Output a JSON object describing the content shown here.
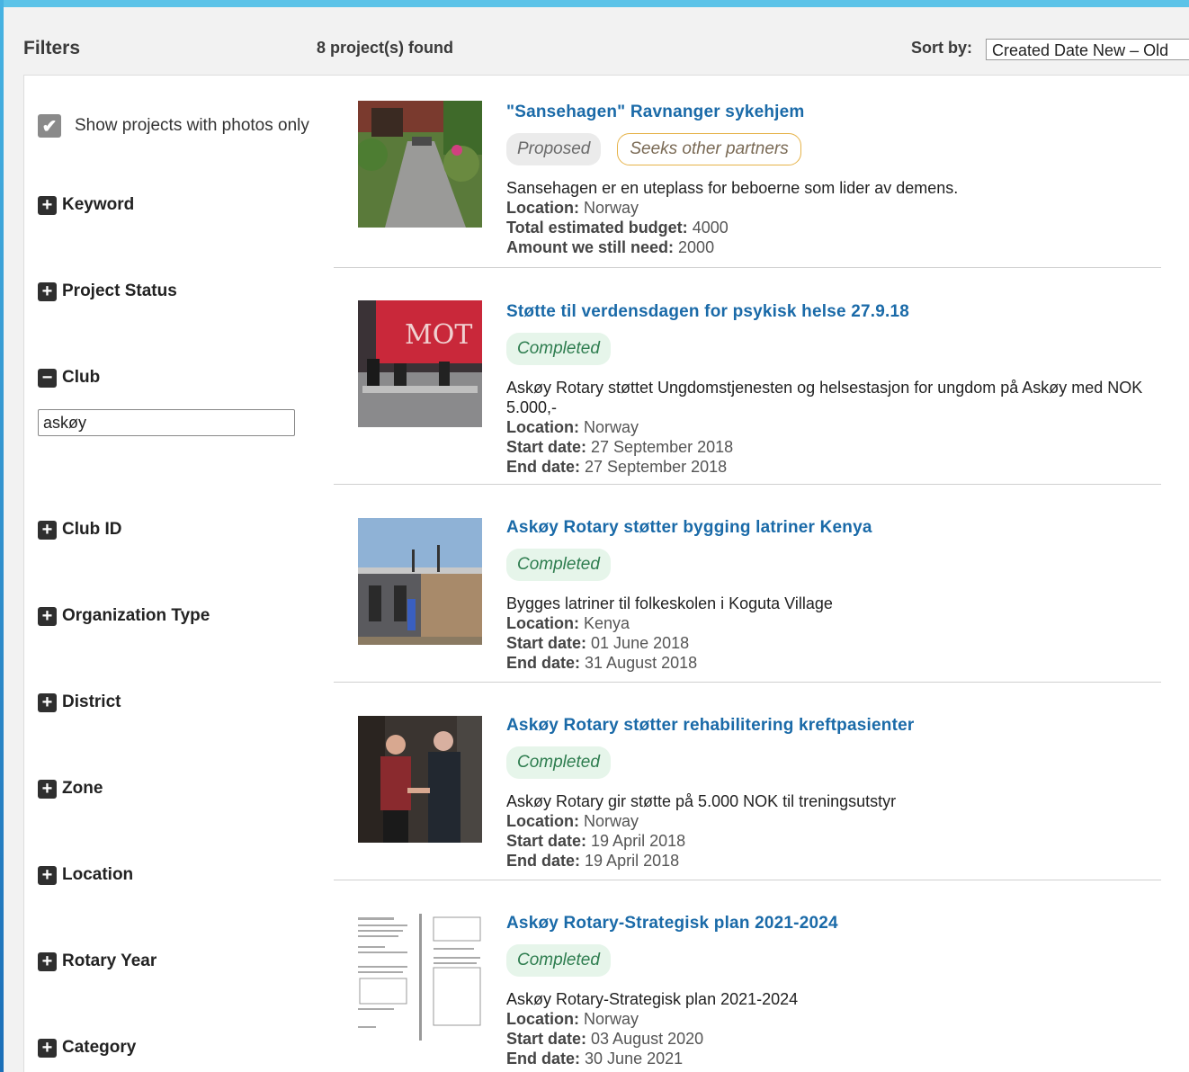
{
  "header": {
    "filters_title": "Filters",
    "result_count": "8 project(s) found",
    "sort_label": "Sort by:",
    "sort_value": "Created Date New – Old"
  },
  "sidebar": {
    "photo_only_label": "Show projects with photos only",
    "photo_only_checked": true,
    "groups": [
      {
        "label": "Keyword",
        "toggle": "+"
      },
      {
        "label": "Project Status",
        "toggle": "+"
      },
      {
        "label": "Club",
        "toggle": "−"
      },
      {
        "label": "Club ID",
        "toggle": "+"
      },
      {
        "label": "Organization Type",
        "toggle": "+"
      },
      {
        "label": "District",
        "toggle": "+"
      },
      {
        "label": "Zone",
        "toggle": "+"
      },
      {
        "label": "Location",
        "toggle": "+"
      },
      {
        "label": "Rotary Year",
        "toggle": "+"
      },
      {
        "label": "Category",
        "toggle": "+"
      }
    ],
    "club_value": "askøy"
  },
  "labels": {
    "location": "Location:",
    "budget": "Total estimated budget:",
    "need": "Amount we still need:",
    "start": "Start date:",
    "end": "End date:"
  },
  "projects": [
    {
      "title": "\"Sansehagen\" Ravnanger sykehjem",
      "status": "Proposed",
      "extra_badge": "Seeks other partners",
      "description": "Sansehagen er en uteplass for beboerne som lider av demens.",
      "location": "Norway",
      "budget": "4000",
      "need": "2000"
    },
    {
      "title": "Støtte til verdensdagen for psykisk helse 27.9.18",
      "status": "Completed",
      "description": "Askøy Rotary støttet Ungdomstjenesten og helsestasjon for ungdom på Askøy med NOK 5.000,-",
      "location": "Norway",
      "start": "27 September 2018",
      "end": "27 September 2018"
    },
    {
      "title": "Askøy Rotary støtter bygging latriner Kenya",
      "status": "Completed",
      "description": "Bygges latriner til folkeskolen i Koguta Village",
      "location": "Kenya",
      "start": "01 June 2018",
      "end": "31 August 2018"
    },
    {
      "title": "Askøy Rotary støtter rehabilitering kreftpasienter",
      "status": "Completed",
      "description": "Askøy Rotary gir støtte på 5.000 NOK til treningsutstyr",
      "location": "Norway",
      "start": "19 April 2018",
      "end": "19 April 2018"
    },
    {
      "title": "Askøy Rotary-Strategisk plan 2021-2024",
      "status": "Completed",
      "description": "Askøy Rotary-Strategisk plan 2021-2024",
      "location": "Norway",
      "start": "03 August 2020",
      "end": "30 June 2021"
    }
  ]
}
